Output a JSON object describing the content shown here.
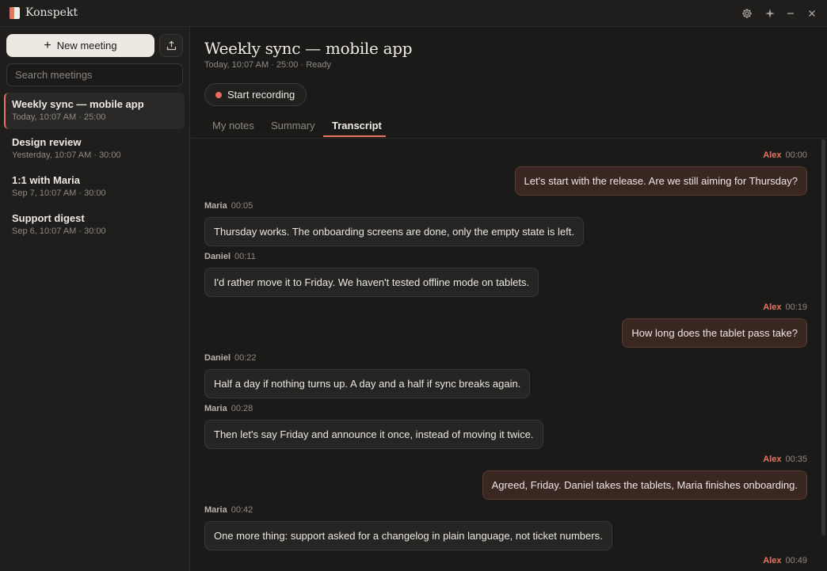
{
  "app": {
    "title": "Konspekt"
  },
  "sidebar": {
    "new_meeting_label": "New meeting",
    "search_placeholder": "Search meetings",
    "meetings": [
      {
        "title": "Weekly sync — mobile app",
        "subtitle": "Today, 10:07 AM · 25:00",
        "active": true
      },
      {
        "title": "Design review",
        "subtitle": "Yesterday, 10:07 AM · 30:00",
        "active": false
      },
      {
        "title": "1:1 with Maria",
        "subtitle": "Sep 7, 10:07 AM · 30:00",
        "active": false
      },
      {
        "title": "Support digest",
        "subtitle": "Sep 6, 10:07 AM · 30:00",
        "active": false
      }
    ]
  },
  "main": {
    "title": "Weekly sync — mobile app",
    "meta": "Today, 10:07 AM · 25:00 · Ready",
    "record_label": "Start recording",
    "tabs": [
      {
        "label": "My notes",
        "active": false
      },
      {
        "label": "Summary",
        "active": false
      },
      {
        "label": "Transcript",
        "active": true
      }
    ]
  },
  "transcript": [
    {
      "speaker": "Alex",
      "time": "00:00",
      "text": "Let's start with the release. Are we still aiming for Thursday?",
      "side": "right"
    },
    {
      "speaker": "Maria",
      "time": "00:05",
      "text": "Thursday works. The onboarding screens are done, only the empty state is left.",
      "side": "left"
    },
    {
      "speaker": "Daniel",
      "time": "00:11",
      "text": "I'd rather move it to Friday. We haven't tested offline mode on tablets.",
      "side": "left"
    },
    {
      "speaker": "Alex",
      "time": "00:19",
      "text": "How long does the tablet pass take?",
      "side": "right"
    },
    {
      "speaker": "Daniel",
      "time": "00:22",
      "text": "Half a day if nothing turns up. A day and a half if sync breaks again.",
      "side": "left"
    },
    {
      "speaker": "Maria",
      "time": "00:28",
      "text": "Then let's say Friday and announce it once, instead of moving it twice.",
      "side": "left"
    },
    {
      "speaker": "Alex",
      "time": "00:35",
      "text": "Agreed, Friday. Daniel takes the tablets, Maria finishes onboarding.",
      "side": "right"
    },
    {
      "speaker": "Maria",
      "time": "00:42",
      "text": "One more thing: support asked for a changelog in plain language, not ticket numbers.",
      "side": "left"
    },
    {
      "speaker": "Alex",
      "time": "00:49",
      "text": "",
      "side": "right"
    }
  ],
  "colors": {
    "accent": "#e4765f",
    "record_dot": "#ea6a5e",
    "background": "#1b1a19"
  }
}
